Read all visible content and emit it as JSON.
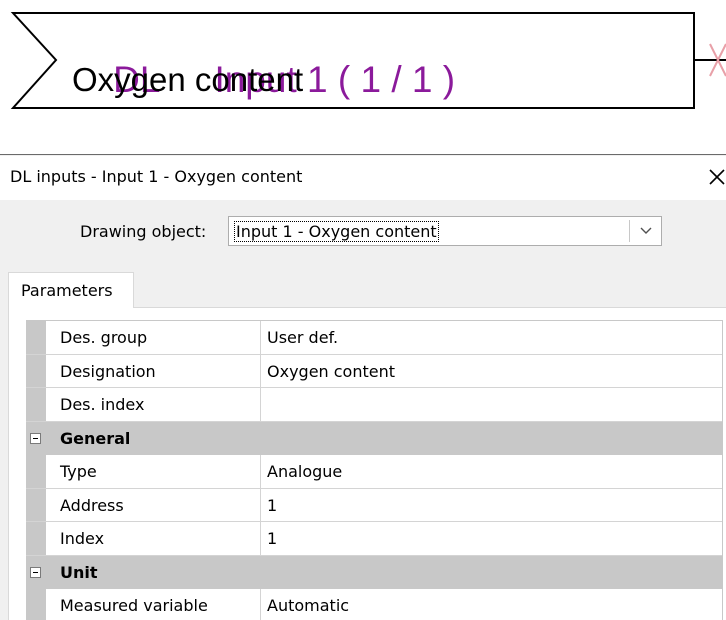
{
  "block": {
    "type_label": "DL",
    "input_label": "Input 1 ( 1 / 1 )",
    "designation": "Oxygen content",
    "accent_color": "#8b1a9b",
    "connector_color": "#e8a0a8"
  },
  "dialog": {
    "title": "DL inputs - Input 1 - Oxygen content",
    "drawing_object_label": "Drawing object:",
    "drawing_object_value": "Input 1 - Oxygen content",
    "tabs": [
      {
        "label": "Parameters",
        "selected": true
      }
    ],
    "grid": {
      "properties_top": [
        {
          "name": "Des. group",
          "value": "User def."
        },
        {
          "name": "Designation",
          "value": "Oxygen content"
        },
        {
          "name": "Des. index",
          "value": ""
        }
      ],
      "category_general": {
        "label": "General",
        "expanded": true,
        "items": [
          {
            "name": "Type",
            "value": "Analogue"
          },
          {
            "name": "Address",
            "value": "1"
          },
          {
            "name": "Index",
            "value": "1"
          }
        ]
      },
      "category_unit": {
        "label": "Unit",
        "expanded": true,
        "items": [
          {
            "name": "Measured variable",
            "value": "Automatic"
          }
        ]
      }
    }
  }
}
